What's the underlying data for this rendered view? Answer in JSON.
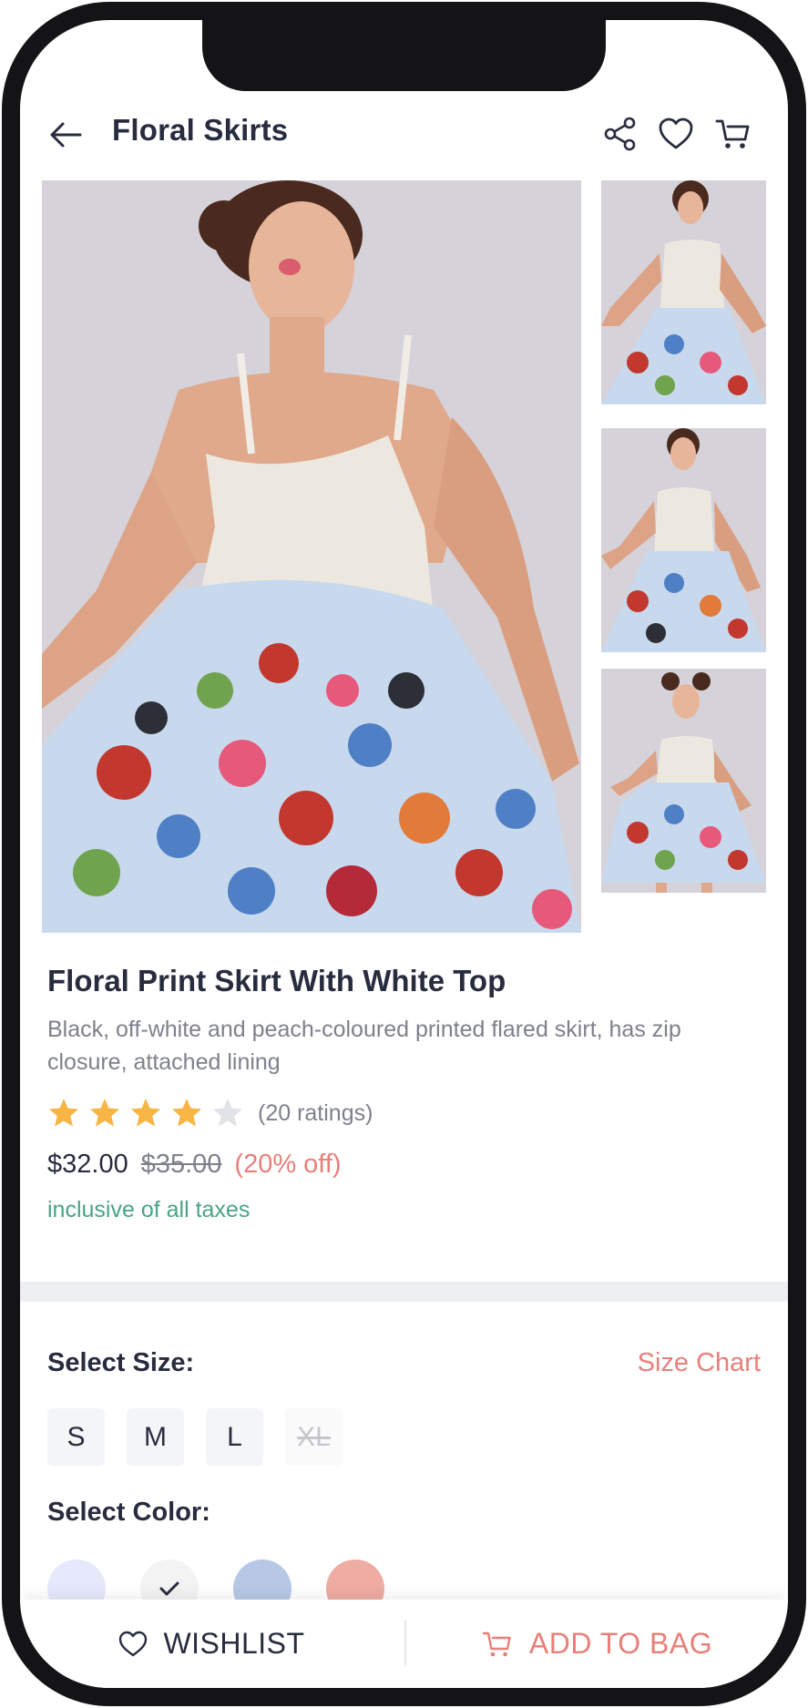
{
  "header": {
    "title": "Floral Skirts",
    "icons": [
      "back-arrow-icon",
      "share-icon",
      "heart-icon",
      "cart-icon"
    ]
  },
  "gallery": {
    "main_image": "model in white top and floral skirt",
    "thumbnails": [
      "pose 1",
      "pose 2",
      "pose 3"
    ]
  },
  "product": {
    "title": "Floral Print Skirt With White Top",
    "description": "Black, off-white and peach-coloured printed flared skirt, has zip closure, attached lining",
    "rating": 4,
    "rating_max": 5,
    "ratings_count_text": "(20 ratings)",
    "price": "$32.00",
    "mrp": "$35.00",
    "discount": "(20% off)",
    "tax_note": "inclusive of all taxes"
  },
  "size": {
    "label": "Select Size:",
    "chart_link": "Size Chart",
    "options": [
      {
        "label": "S",
        "available": true
      },
      {
        "label": "M",
        "available": true
      },
      {
        "label": "L",
        "available": true
      },
      {
        "label": "XL",
        "available": false
      }
    ]
  },
  "color": {
    "label": "Select Color:",
    "swatches": [
      {
        "hex": "#e6e8fb",
        "selected": false
      },
      {
        "hex": "#f3f3f4",
        "selected": true
      },
      {
        "hex": "#b6c8e6",
        "selected": false
      },
      {
        "hex": "#eeaca2",
        "selected": false
      }
    ]
  },
  "actions": {
    "wishlist_label": "WISHLIST",
    "add_to_bag_label": "ADD TO BAG"
  },
  "colors": {
    "accent": "#e8807a",
    "tax_green": "#4aa388",
    "star": "#f7b545",
    "star_empty": "#e2e3e6"
  }
}
